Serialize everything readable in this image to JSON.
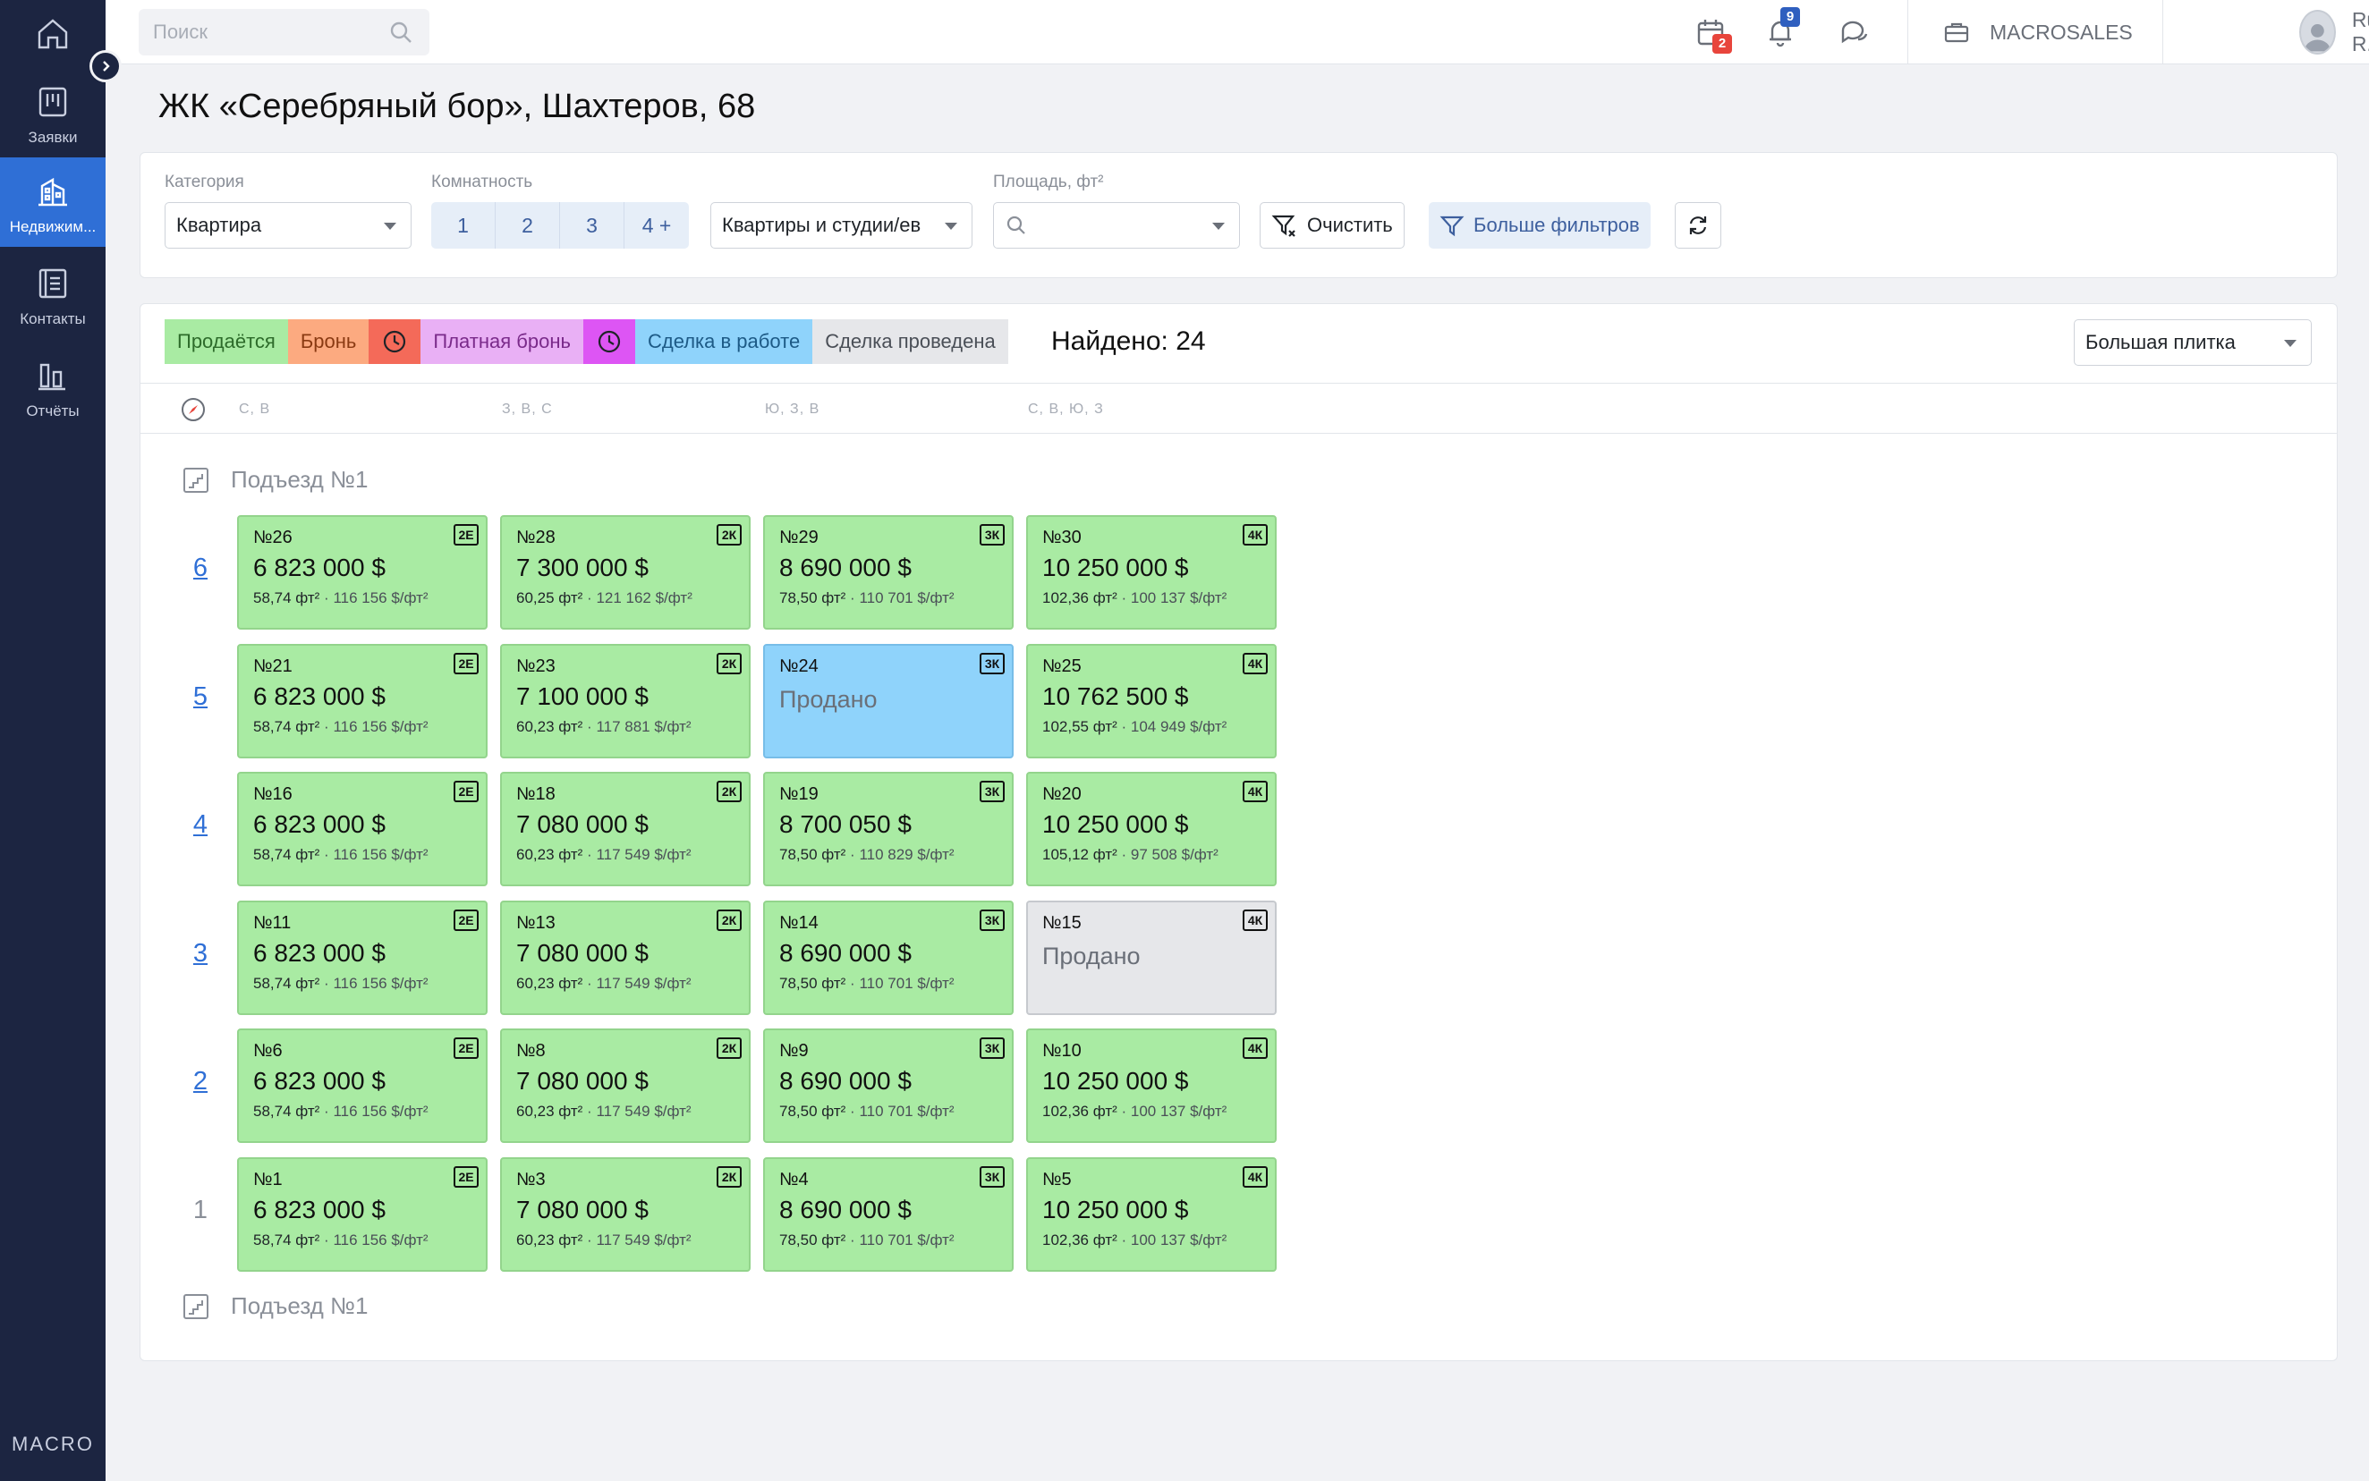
{
  "sidebar": {
    "brand": "MACRO",
    "items": [
      {
        "label": ""
      },
      {
        "label": "Заявки"
      },
      {
        "label": "Недвижим..."
      },
      {
        "label": "Контакты"
      },
      {
        "label": "Отчёты"
      }
    ]
  },
  "topbar": {
    "search_placeholder": "Поиск",
    "calendar_badge": "2",
    "notifications_badge": "9",
    "company": "MACROSALES",
    "user_name": "Ruslan R."
  },
  "page": {
    "title": "ЖК «Серебряный бор», Шахтеров, 68"
  },
  "filters": {
    "category_label": "Категория",
    "category_value": "Квартира",
    "rooms_label": "Комнатность",
    "rooms": [
      "1",
      "2",
      "3",
      "4 +"
    ],
    "type_value": "Квартиры и студии/ев",
    "area_label": "Площадь, фт²",
    "area_value": "",
    "clear_label": "Очистить",
    "more_label": "Больше фильтров"
  },
  "statuses": {
    "items": [
      {
        "label": "Продаётся",
        "color": "#a9eba3"
      },
      {
        "label": "Бронь",
        "color": "#fcaa80"
      },
      {
        "label": "",
        "color": "#f46a59",
        "icon": "clock-icon"
      },
      {
        "label": "Платная бронь",
        "color": "#e9b0f5"
      },
      {
        "label": "",
        "color": "#dd55f4",
        "icon": "clock-icon"
      },
      {
        "label": "Сделка в работе",
        "color": "#8fd3fb"
      },
      {
        "label": "Сделка проведена",
        "color": "#e6e7ea"
      }
    ],
    "found": "Найдено: 24",
    "view_value": "Большая плитка"
  },
  "directions": [
    "С, В",
    "З, В, С",
    "Ю, З, В",
    "С, В, Ю, З"
  ],
  "board": {
    "entrance_label_top": "Подъезд №1",
    "entrance_label_bottom": "Подъезд №1",
    "floors": [
      {
        "number": "6",
        "link": true,
        "units": [
          {
            "no": "№26",
            "type": "2Е",
            "status": "available",
            "price": "6 823 000 $",
            "area": "58,74 фт²",
            "ppm": "116 156 $/фт²"
          },
          {
            "no": "№28",
            "type": "2К",
            "status": "available",
            "price": "7 300 000 $",
            "area": "60,25 фт²",
            "ppm": "121 162 $/фт²"
          },
          {
            "no": "№29",
            "type": "3К",
            "status": "available",
            "price": "8 690 000 $",
            "area": "78,50 фт²",
            "ppm": "110 701 $/фт²"
          },
          {
            "no": "№30",
            "type": "4К",
            "status": "available",
            "price": "10 250 000 $",
            "area": "102,36 фт²",
            "ppm": "100 137 $/фт²"
          }
        ]
      },
      {
        "number": "5",
        "link": true,
        "units": [
          {
            "no": "№21",
            "type": "2Е",
            "status": "available",
            "price": "6 823 000 $",
            "area": "58,74 фт²",
            "ppm": "116 156 $/фт²"
          },
          {
            "no": "№23",
            "type": "2К",
            "status": "available",
            "price": "7 100 000 $",
            "area": "60,23 фт²",
            "ppm": "117 881 $/фт²"
          },
          {
            "no": "№24",
            "type": "3К",
            "status": "deal",
            "sold": "Продано"
          },
          {
            "no": "№25",
            "type": "4К",
            "status": "available",
            "price": "10 762 500 $",
            "area": "102,55 фт²",
            "ppm": "104 949 $/фт²"
          }
        ]
      },
      {
        "number": "4",
        "link": true,
        "units": [
          {
            "no": "№16",
            "type": "2Е",
            "status": "available",
            "price": "6 823 000 $",
            "area": "58,74 фт²",
            "ppm": "116 156 $/фт²"
          },
          {
            "no": "№18",
            "type": "2К",
            "status": "available",
            "price": "7 080 000 $",
            "area": "60,23 фт²",
            "ppm": "117 549 $/фт²"
          },
          {
            "no": "№19",
            "type": "3К",
            "status": "available",
            "price": "8 700 050 $",
            "area": "78,50 фт²",
            "ppm": "110 829 $/фт²"
          },
          {
            "no": "№20",
            "type": "4К",
            "status": "available",
            "price": "10 250 000 $",
            "area": "105,12 фт²",
            "ppm": "97 508 $/фт²"
          }
        ]
      },
      {
        "number": "3",
        "link": true,
        "units": [
          {
            "no": "№11",
            "type": "2Е",
            "status": "available",
            "price": "6 823 000 $",
            "area": "58,74 фт²",
            "ppm": "116 156 $/фт²"
          },
          {
            "no": "№13",
            "type": "2К",
            "status": "available",
            "price": "7 080 000 $",
            "area": "60,23 фт²",
            "ppm": "117 549 $/фт²"
          },
          {
            "no": "№14",
            "type": "3К",
            "status": "available",
            "price": "8 690 000 $",
            "area": "78,50 фт²",
            "ppm": "110 701 $/фт²"
          },
          {
            "no": "№15",
            "type": "4К",
            "status": "closed",
            "sold": "Продано"
          }
        ]
      },
      {
        "number": "2",
        "link": true,
        "units": [
          {
            "no": "№6",
            "type": "2Е",
            "status": "available",
            "price": "6 823 000 $",
            "area": "58,74 фт²",
            "ppm": "116 156 $/фт²"
          },
          {
            "no": "№8",
            "type": "2К",
            "status": "available",
            "price": "7 080 000 $",
            "area": "60,23 фт²",
            "ppm": "117 549 $/фт²"
          },
          {
            "no": "№9",
            "type": "3К",
            "status": "available",
            "price": "8 690 000 $",
            "area": "78,50 фт²",
            "ppm": "110 701 $/фт²"
          },
          {
            "no": "№10",
            "type": "4К",
            "status": "available",
            "price": "10 250 000 $",
            "area": "102,36 фт²",
            "ppm": "100 137 $/фт²"
          }
        ]
      },
      {
        "number": "1",
        "link": false,
        "units": [
          {
            "no": "№1",
            "type": "2Е",
            "status": "available",
            "price": "6 823 000 $",
            "area": "58,74 фт²",
            "ppm": "116 156 $/фт²"
          },
          {
            "no": "№3",
            "type": "2К",
            "status": "available",
            "price": "7 080 000 $",
            "area": "60,23 фт²",
            "ppm": "117 549 $/фт²"
          },
          {
            "no": "№4",
            "type": "3К",
            "status": "available",
            "price": "8 690 000 $",
            "area": "78,50 фт²",
            "ppm": "110 701 $/фт²"
          },
          {
            "no": "№5",
            "type": "4К",
            "status": "available",
            "price": "10 250 000 $",
            "area": "102,36 фт²",
            "ppm": "100 137 $/фт²"
          }
        ]
      }
    ]
  }
}
